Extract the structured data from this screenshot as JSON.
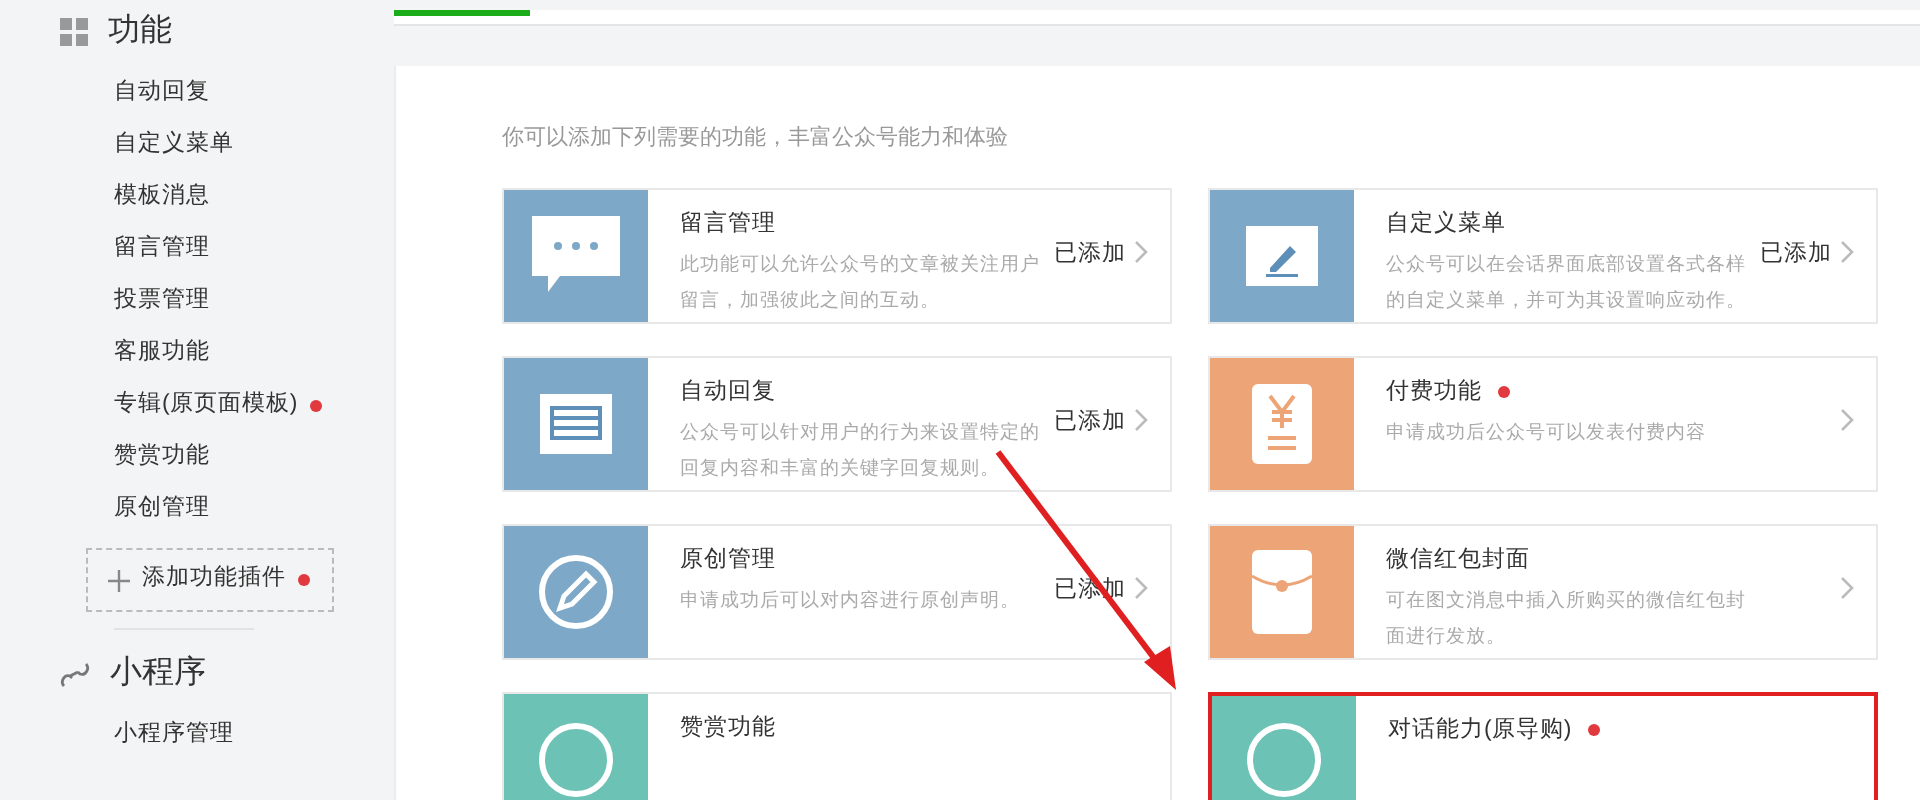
{
  "sidebar": {
    "sections": [
      {
        "title": "功能",
        "items": [
          {
            "label": "自动回复",
            "dot": false
          },
          {
            "label": "自定义菜单",
            "dot": false
          },
          {
            "label": "模板消息",
            "dot": false
          },
          {
            "label": "留言管理",
            "dot": false
          },
          {
            "label": "投票管理",
            "dot": false
          },
          {
            "label": "客服功能",
            "dot": false
          },
          {
            "label": "专辑(原页面模板)",
            "dot": true
          },
          {
            "label": "赞赏功能",
            "dot": false
          },
          {
            "label": "原创管理",
            "dot": false
          }
        ],
        "add_button": {
          "label": "添加功能插件",
          "dot": true
        }
      },
      {
        "title": "小程序",
        "items": [
          {
            "label": "小程序管理",
            "dot": false
          }
        ]
      }
    ]
  },
  "intro": "你可以添加下列需要的功能，丰富公众号能力和体验",
  "cards": [
    {
      "color": "#7ea8c8",
      "title": "留言管理",
      "dot": false,
      "description": "此功能可以允许公众号的文章被关注用户留言，加强彼此之间的互动。",
      "status": "已添加",
      "highlighted": false
    },
    {
      "color": "#7ea8c8",
      "title": "自定义菜单",
      "dot": false,
      "description": "公众号可以在会话界面底部设置各式各样的自定义菜单，并可为其设置响应动作。",
      "status": "已添加",
      "highlighted": false
    },
    {
      "color": "#7ea8c8",
      "title": "自动回复",
      "dot": false,
      "description": "公众号可以针对用户的行为来设置特定的回复内容和丰富的关键字回复规则。",
      "status": "已添加",
      "highlighted": false
    },
    {
      "color": "#eda577",
      "title": "付费功能",
      "dot": true,
      "description": "申请成功后公众号可以发表付费内容",
      "highlighted": false
    },
    {
      "color": "#7ea8c8",
      "title": "原创管理",
      "dot": false,
      "description": "申请成功后可以对内容进行原创声明。",
      "status": "已添加",
      "highlighted": false
    },
    {
      "color": "#eda577",
      "title": "微信红包封面",
      "dot": false,
      "description": "可在图文消息中插入所购买的微信红包封面进行发放。",
      "highlighted": false
    },
    {
      "color": "#6cc3b5",
      "title": "赞赏功能",
      "dot": false,
      "highlighted": false
    },
    {
      "color": "#6cc3b5",
      "title": "对话能力(原导购)",
      "dot": true,
      "highlighted": true
    }
  ]
}
